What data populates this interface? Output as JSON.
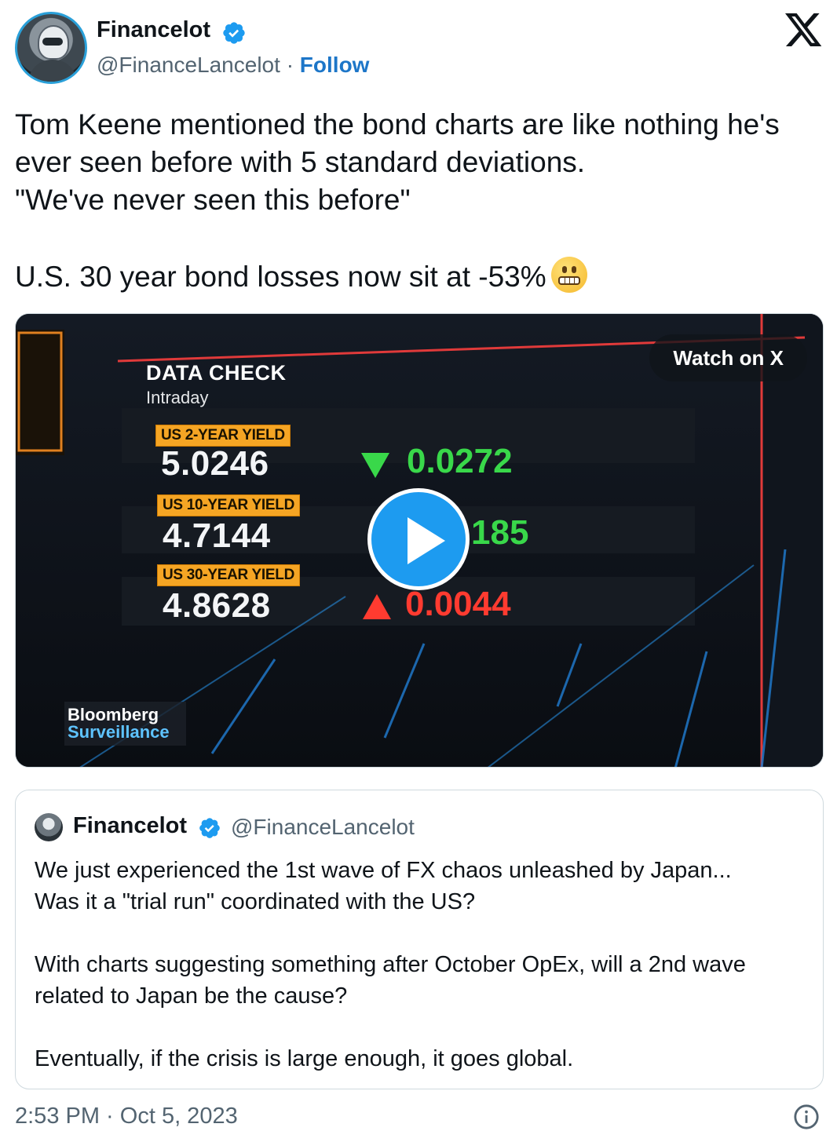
{
  "tweet": {
    "author": {
      "name": "Financelot",
      "handle": "@FinanceLancelot",
      "separator": "·",
      "follow_label": "Follow"
    },
    "text": "Tom Keene mentioned the bond charts are like nothing he's ever seen before with 5 standard deviations.\n\"We've never seen this before\"\n\nU.S. 30 year bond losses now sit at -53%",
    "emoji": "grimacing-face",
    "timestamp": "2:53 PM · Oct 5, 2023"
  },
  "video": {
    "watch_label": "Watch on X",
    "data_check_title": "DATA CHECK",
    "data_check_subtitle": "Intraday",
    "rows": [
      {
        "label": "US 2-YEAR YIELD",
        "value": "5.0246",
        "change": "0.0272",
        "direction": "down"
      },
      {
        "label": "US 10-YEAR YIELD",
        "value": "4.7144",
        "change": "185",
        "direction": "down"
      },
      {
        "label": "US 30-YEAR YIELD",
        "value": "4.8628",
        "change": "0.0044",
        "direction": "up"
      }
    ],
    "brand_line1": "Bloomberg",
    "brand_line2": "Surveillance"
  },
  "quoted_tweet": {
    "name": "Financelot",
    "handle": "@FinanceLancelot",
    "text": "We just experienced the 1st wave of FX chaos unleashed by Japan...\nWas it a \"trial run\" coordinated with the US?\n\nWith charts suggesting something after October OpEx, will a 2nd wave related to Japan be the cause?\n\nEventually, if the crisis is large enough, it goes global."
  },
  "colors": {
    "link": "#1d76c8",
    "verified": "#1d9bf0",
    "secondary_text": "#536471",
    "yield_label_bg": "#f5a524",
    "change_down": "#39d84a",
    "change_up": "#ff3b30"
  }
}
